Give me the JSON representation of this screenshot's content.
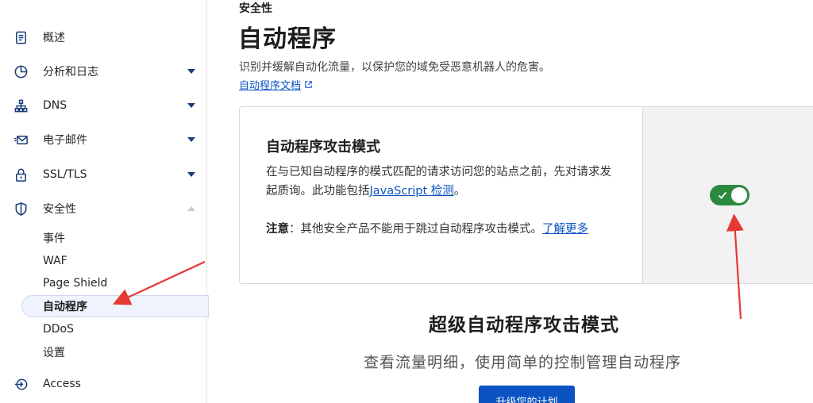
{
  "sidebar": {
    "items": [
      {
        "label": "概述",
        "icon": "document-icon"
      },
      {
        "label": "分析和日志",
        "icon": "chart-pie-icon"
      },
      {
        "label": "DNS",
        "icon": "network-icon"
      },
      {
        "label": "电子邮件",
        "icon": "email-icon"
      },
      {
        "label": "SSL/TLS",
        "icon": "lock-icon"
      },
      {
        "label": "安全性",
        "icon": "shield-icon"
      }
    ],
    "sub_items": [
      "事件",
      "WAF",
      "Page Shield",
      "自动程序",
      "DDoS",
      "设置"
    ],
    "access": {
      "label": "Access",
      "icon": "login-icon"
    }
  },
  "main": {
    "eyebrow": "安全性",
    "title": "自动程序",
    "description": "识别并缓解自动化流量，以保护您的域免受恶意机器人的危害。",
    "doc_link": "自动程序文档"
  },
  "card": {
    "title": "自动程序攻击模式",
    "text": "在与已知自动程序的模式匹配的请求访问您的站点之前，先对请求发起质询。此功能包括",
    "text_link": "JavaScript 检测",
    "text_end": "。",
    "note_label": "注意",
    "note_text": "：其他安全产品不能用于跳过自动程序攻击模式。",
    "note_link": "了解更多",
    "toggle_on": true
  },
  "upsell": {
    "title": "超级自动程序攻击模式",
    "description": "查看流量明细，使用简单的控制管理自动程序",
    "button": "升级您的计划"
  },
  "colors": {
    "accent": "#0b52c2",
    "toggle_on": "#2c8a3f",
    "annotation_arrow": "#e53935"
  }
}
